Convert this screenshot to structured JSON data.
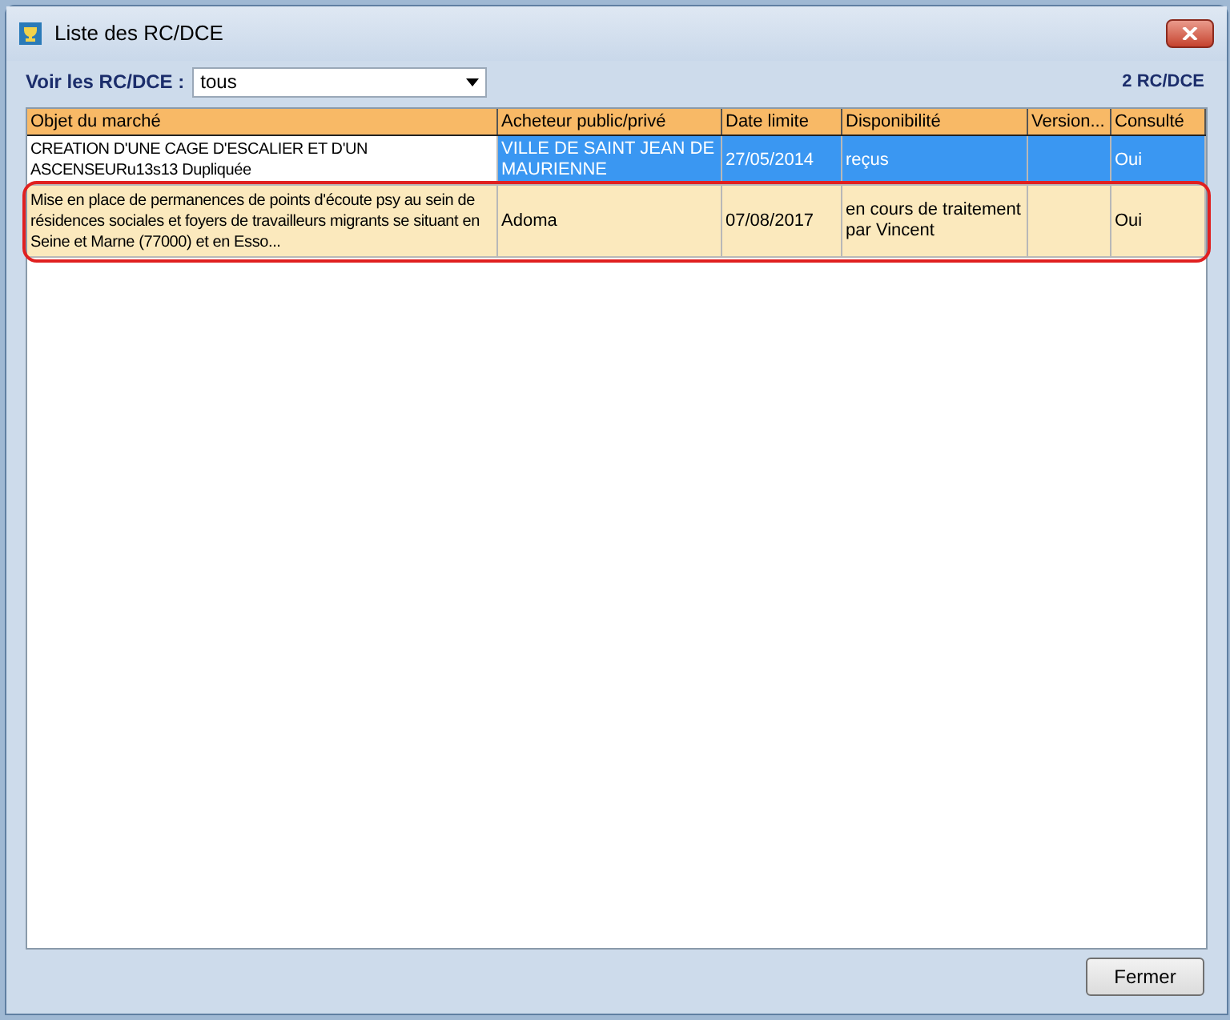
{
  "window": {
    "title": "Liste des RC/DCE"
  },
  "filter": {
    "label": "Voir les RC/DCE :",
    "value": "tous"
  },
  "count": "2 RC/DCE",
  "table": {
    "columns": [
      "Objet du marché",
      "Acheteur public/privé",
      "Date limite",
      "Disponibilité",
      "Version...",
      "Consulté"
    ],
    "rows": [
      {
        "selected": true,
        "highlighted": false,
        "cells": [
          "CREATION D'UNE CAGE D'ESCALIER ET D'UN ASCENSEURu13s13 Dupliquée",
          "VILLE DE SAINT JEAN DE MAURIENNE",
          "27/05/2014",
          "reçus",
          "",
          "Oui"
        ]
      },
      {
        "selected": false,
        "highlighted": true,
        "cells": [
          "Mise en place de permanences de points d'écoute psy au sein de résidences sociales et foyers de travailleurs migrants se situant en Seine et Marne (77000) et en Esso...",
          "Adoma",
          "07/08/2017",
          "en cours de traitement par Vincent",
          "",
          "Oui"
        ]
      }
    ]
  },
  "buttons": [
    "Fermer"
  ]
}
